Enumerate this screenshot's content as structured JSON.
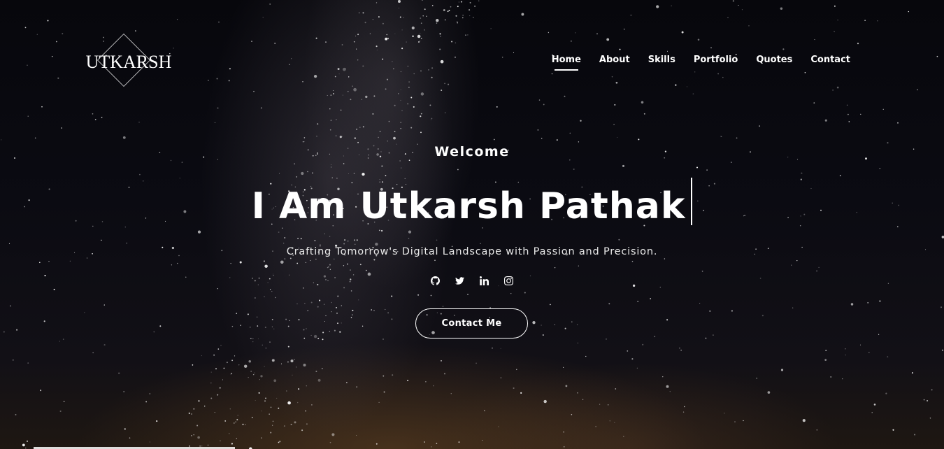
{
  "brand": {
    "logo_text": "UTKARSH"
  },
  "nav": {
    "items": [
      {
        "label": "Home",
        "active": true
      },
      {
        "label": "About",
        "active": false
      },
      {
        "label": "Skills",
        "active": false
      },
      {
        "label": "Portfolio",
        "active": false
      },
      {
        "label": "Quotes",
        "active": false
      },
      {
        "label": "Contact",
        "active": false
      }
    ]
  },
  "hero": {
    "welcome": "Welcome",
    "headline": "I Am Utkarsh Pathak",
    "tagline": "Crafting Tomorrow's Digital Landscape with Passion and Precision.",
    "socials": [
      "github-icon",
      "twitter-icon",
      "linkedin-icon",
      "instagram-icon"
    ],
    "cta_label": "Contact Me"
  },
  "colors": {
    "text": "#ffffff",
    "background": "#0a0a10"
  }
}
